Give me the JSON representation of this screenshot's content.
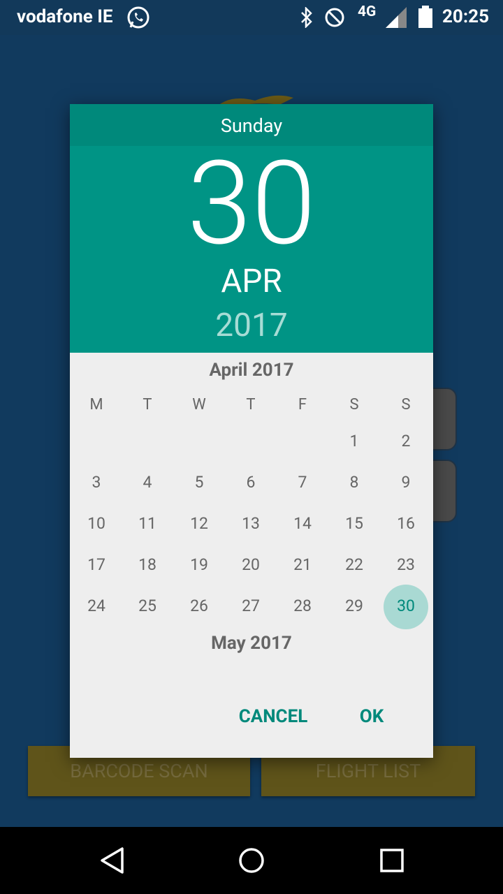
{
  "status_bar": {
    "carrier": "vodafone IE",
    "network": "4G",
    "time": "20:25",
    "icons": [
      "whatsapp-icon",
      "bluetooth-icon",
      "do-not-disturb-icon",
      "signal-icon",
      "battery-icon"
    ]
  },
  "background_app": {
    "buttons": {
      "barcode_scan": "BARCODE SCAN",
      "flight_list": "FLIGHT LIST"
    }
  },
  "date_picker": {
    "header": {
      "weekday": "Sunday",
      "day": "30",
      "month": "APR",
      "year": "2017"
    },
    "accent_color": "#009485",
    "april": {
      "title": "April 2017",
      "weekdays": [
        "M",
        "T",
        "W",
        "T",
        "F",
        "S",
        "S"
      ],
      "weeks": [
        [
          "",
          "",
          "",
          "",
          "",
          "1",
          "2"
        ],
        [
          "3",
          "4",
          "5",
          "6",
          "7",
          "8",
          "9"
        ],
        [
          "10",
          "11",
          "12",
          "13",
          "14",
          "15",
          "16"
        ],
        [
          "17",
          "18",
          "19",
          "20",
          "21",
          "22",
          "23"
        ],
        [
          "24",
          "25",
          "26",
          "27",
          "28",
          "29",
          "30"
        ]
      ],
      "selected_day": "30"
    },
    "next_month": {
      "title": "May 2017"
    },
    "buttons": {
      "cancel": "CANCEL",
      "ok": "OK"
    }
  },
  "nav_bar": {
    "icons": [
      "back-icon",
      "home-icon",
      "recents-icon"
    ]
  }
}
